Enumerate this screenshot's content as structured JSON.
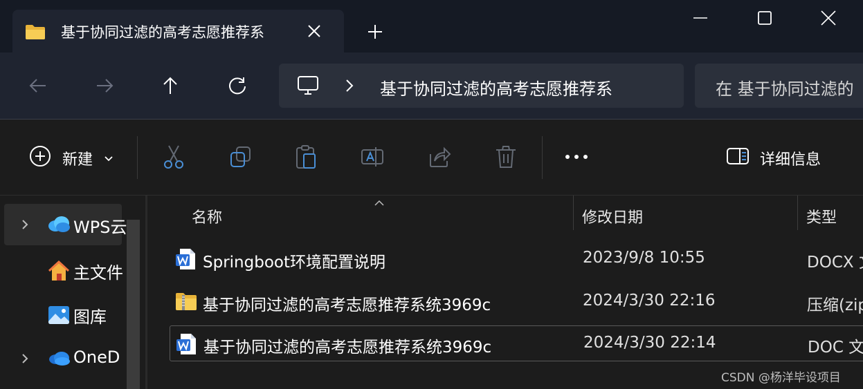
{
  "tab": {
    "title": "基于协同过滤的高考志愿推荐系",
    "folder_icon": "folder-icon",
    "close_icon": "close-icon"
  },
  "window": {
    "new_tab_icon": "plus-icon",
    "minimize_icon": "minimize-icon",
    "maximize_icon": "maximize-icon",
    "close_icon": "close-icon"
  },
  "nav": {
    "back_icon": "arrow-left-icon",
    "forward_icon": "arrow-right-icon",
    "up_icon": "arrow-up-icon",
    "refresh_icon": "refresh-icon",
    "address_text": "基于协同过滤的高考志愿推荐系",
    "search_text": "在 基于协同过滤的"
  },
  "toolbar": {
    "new_label": "新建",
    "details_label": "详细信息",
    "icons": [
      "cut-icon",
      "copy-icon",
      "paste-icon",
      "rename-icon",
      "share-icon",
      "delete-icon",
      "more-icon"
    ]
  },
  "sidebar": {
    "items": [
      {
        "label": "WPS云",
        "icon": "wps-cloud-icon",
        "has_chevron": true,
        "selected": true
      },
      {
        "label": "主文件",
        "icon": "home-icon",
        "has_chevron": false,
        "selected": false
      },
      {
        "label": "图库",
        "icon": "gallery-icon",
        "has_chevron": false,
        "selected": false
      },
      {
        "label": "OneD",
        "icon": "onedrive-icon",
        "has_chevron": true,
        "selected": false
      }
    ]
  },
  "columns": {
    "name": "名称",
    "date": "修改日期",
    "type": "类型"
  },
  "files": [
    {
      "name": "Springboot环境配置说明",
      "date": "2023/9/8 10:55",
      "type": "DOCX 文",
      "icon": "word-doc-icon"
    },
    {
      "name": "基于协同过滤的高考志愿推荐系统3969c",
      "date": "2024/3/30 22:16",
      "type": "压缩(zip",
      "icon": "zip-folder-icon"
    },
    {
      "name": "基于协同过滤的高考志愿推荐系统3969c",
      "date": "2024/3/30 22:14",
      "type": "DOC 文",
      "icon": "word-doc-icon"
    }
  ],
  "watermark": "CSDN @杨洋毕设项目",
  "colors": {
    "titlebar": "#151a24",
    "navbar": "#1f2430",
    "field": "#2b303b",
    "content": "#1c1c1c",
    "folder": "#f5c542",
    "word": "#2b6fd6"
  }
}
